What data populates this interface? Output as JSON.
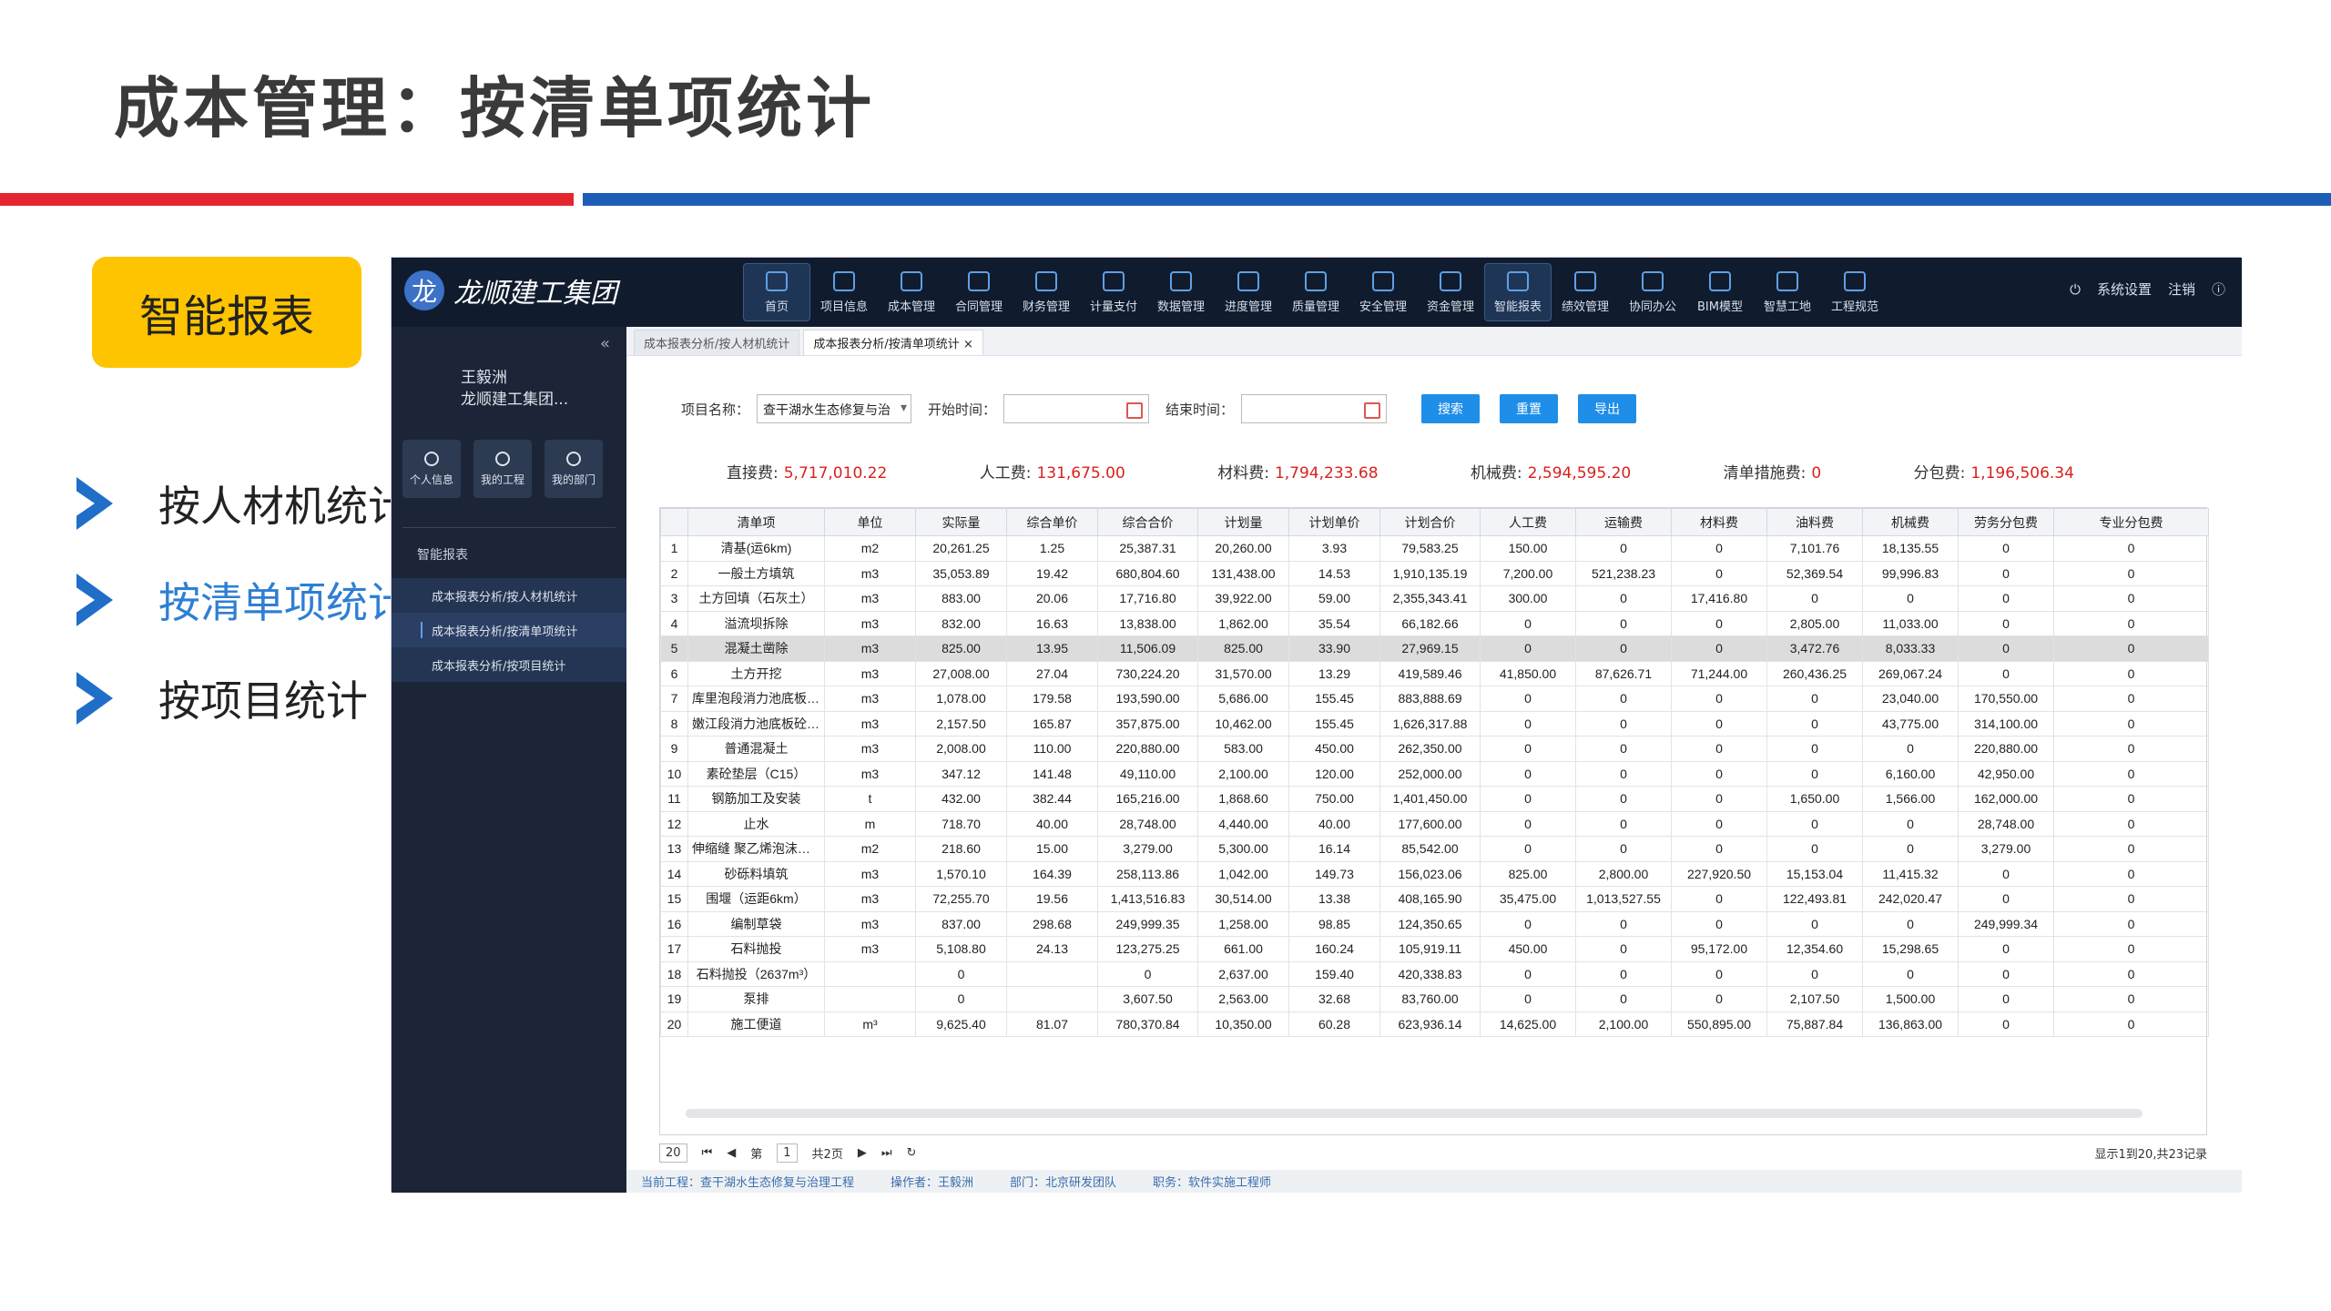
{
  "slide": {
    "title": "成本管理：按清单项统计",
    "badge": "智能报表",
    "nav": [
      "按人材机统计",
      "按清单项统计",
      "按项目统计"
    ]
  },
  "app": {
    "logo_mark": "龙",
    "logo_text": "龙顺建工集团",
    "menu": [
      "首页",
      "项目信息",
      "成本管理",
      "合同管理",
      "财务管理",
      "计量支付",
      "数据管理",
      "进度管理",
      "质量管理",
      "安全管理",
      "资金管理",
      "智能报表",
      "绩效管理",
      "协同办公",
      "BIM模型",
      "智慧工地",
      "工程规范"
    ],
    "top_right": {
      "settings": "系统设置",
      "logout": "注销",
      "help_icon": "ⓘ",
      "power_icon": "⏻"
    },
    "sidebar": {
      "collapse": "«",
      "user_name": "王毅洲",
      "user_org": "龙顺建工集团...",
      "quick": [
        "个人信息",
        "我的工程",
        "我的部门"
      ],
      "section": "智能报表",
      "subitems": [
        "成本报表分析/按人材机统计",
        "成本报表分析/按清单项统计",
        "成本报表分析/按项目统计"
      ]
    },
    "tabs": [
      "成本报表分析/按人材机统计",
      "成本报表分析/按清单项统计 ×"
    ],
    "filters": {
      "project_label": "项目名称：",
      "project_value": "查干湖水生态修复与治",
      "start_label": "开始时间：",
      "end_label": "结束时间：",
      "search": "搜索",
      "reset": "重置",
      "export": "导出"
    },
    "sums": [
      {
        "label": "直接费:",
        "value": "5,717,010.22"
      },
      {
        "label": "人工费:",
        "value": "131,675.00"
      },
      {
        "label": "材料费:",
        "value": "1,794,233.68"
      },
      {
        "label": "机械费:",
        "value": "2,594,595.20"
      },
      {
        "label": "清单措施费:",
        "value": "0"
      },
      {
        "label": "分包费:",
        "value": "1,196,506.34"
      }
    ],
    "columns": [
      "",
      "清单项",
      "单位",
      "实际量",
      "综合单价",
      "综合合价",
      "计划量",
      "计划单价",
      "计划合价",
      "人工费",
      "运输费",
      "材料费",
      "油料费",
      "机械费",
      "劳务分包费",
      "专业分包费"
    ],
    "rows": [
      [
        "1",
        "清基(运6km)",
        "m2",
        "20,261.25",
        "1.25",
        "25,387.31",
        "20,260.00",
        "3.93",
        "79,583.25",
        "150.00",
        "0",
        "0",
        "7,101.76",
        "18,135.55",
        "0",
        "0"
      ],
      [
        "2",
        "一般土方填筑",
        "m3",
        "35,053.89",
        "19.42",
        "680,804.60",
        "131,438.00",
        "14.53",
        "1,910,135.19",
        "7,200.00",
        "521,238.23",
        "0",
        "52,369.54",
        "99,996.83",
        "0",
        "0"
      ],
      [
        "3",
        "土方回填（石灰土）",
        "m3",
        "883.00",
        "20.06",
        "17,716.80",
        "39,922.00",
        "59.00",
        "2,355,343.41",
        "300.00",
        "0",
        "17,416.80",
        "0",
        "0",
        "0",
        "0"
      ],
      [
        "4",
        "溢流坝拆除",
        "m3",
        "832.00",
        "16.63",
        "13,838.00",
        "1,862.00",
        "35.54",
        "66,182.66",
        "0",
        "0",
        "0",
        "2,805.00",
        "11,033.00",
        "0",
        "0"
      ],
      [
        "5",
        "混凝土凿除",
        "m3",
        "825.00",
        "13.95",
        "11,506.09",
        "825.00",
        "33.90",
        "27,969.15",
        "0",
        "0",
        "0",
        "3,472.76",
        "8,033.33",
        "0",
        "0"
      ],
      [
        "6",
        "土方开挖",
        "m3",
        "27,008.00",
        "27.04",
        "730,224.20",
        "31,570.00",
        "13.29",
        "419,589.46",
        "41,850.00",
        "87,626.71",
        "71,244.00",
        "260,436.25",
        "269,067.24",
        "0",
        "0"
      ],
      [
        "7",
        "库里泡段消力池底板砼...",
        "m3",
        "1,078.00",
        "179.58",
        "193,590.00",
        "5,686.00",
        "155.45",
        "883,888.69",
        "0",
        "0",
        "0",
        "0",
        "23,040.00",
        "170,550.00",
        "0"
      ],
      [
        "8",
        "嫩江段消力池底板砼C...",
        "m3",
        "2,157.50",
        "165.87",
        "357,875.00",
        "10,462.00",
        "155.45",
        "1,626,317.88",
        "0",
        "0",
        "0",
        "0",
        "43,775.00",
        "314,100.00",
        "0"
      ],
      [
        "9",
        "普通混凝土",
        "m3",
        "2,008.00",
        "110.00",
        "220,880.00",
        "583.00",
        "450.00",
        "262,350.00",
        "0",
        "0",
        "0",
        "0",
        "0",
        "220,880.00",
        "0"
      ],
      [
        "10",
        "素砼垫层（C15）",
        "m3",
        "347.12",
        "141.48",
        "49,110.00",
        "2,100.00",
        "120.00",
        "252,000.00",
        "0",
        "0",
        "0",
        "0",
        "6,160.00",
        "42,950.00",
        "0"
      ],
      [
        "11",
        "钢筋加工及安装",
        "t",
        "432.00",
        "382.44",
        "165,216.00",
        "1,868.60",
        "750.00",
        "1,401,450.00",
        "0",
        "0",
        "0",
        "1,650.00",
        "1,566.00",
        "162,000.00",
        "0"
      ],
      [
        "12",
        "止水",
        "m",
        "718.70",
        "40.00",
        "28,748.00",
        "4,440.00",
        "40.00",
        "177,600.00",
        "0",
        "0",
        "0",
        "0",
        "0",
        "28,748.00",
        "0"
      ],
      [
        "13",
        "伸缩缝 聚乙烯泡沫填...",
        "m2",
        "218.60",
        "15.00",
        "3,279.00",
        "5,300.00",
        "16.14",
        "85,542.00",
        "0",
        "0",
        "0",
        "0",
        "0",
        "3,279.00",
        "0"
      ],
      [
        "14",
        "砂砾料填筑",
        "m3",
        "1,570.10",
        "164.39",
        "258,113.86",
        "1,042.00",
        "149.73",
        "156,023.06",
        "825.00",
        "2,800.00",
        "227,920.50",
        "15,153.04",
        "11,415.32",
        "0",
        "0"
      ],
      [
        "15",
        "围堰（运距6km）",
        "m3",
        "72,255.70",
        "19.56",
        "1,413,516.83",
        "30,514.00",
        "13.38",
        "408,165.90",
        "35,475.00",
        "1,013,527.55",
        "0",
        "122,493.81",
        "242,020.47",
        "0",
        "0"
      ],
      [
        "16",
        "编制草袋",
        "m3",
        "837.00",
        "298.68",
        "249,999.35",
        "1,258.00",
        "98.85",
        "124,350.65",
        "0",
        "0",
        "0",
        "0",
        "0",
        "249,999.34",
        "0"
      ],
      [
        "17",
        "石料抛投",
        "m3",
        "5,108.80",
        "24.13",
        "123,275.25",
        "661.00",
        "160.24",
        "105,919.11",
        "450.00",
        "0",
        "95,172.00",
        "12,354.60",
        "15,298.65",
        "0",
        "0"
      ],
      [
        "18",
        "石料抛投（2637m³）",
        "",
        "0",
        "",
        "0",
        "2,637.00",
        "159.40",
        "420,338.83",
        "0",
        "0",
        "0",
        "0",
        "0",
        "0",
        "0"
      ],
      [
        "19",
        "泵排",
        "",
        "0",
        "",
        "3,607.50",
        "2,563.00",
        "32.68",
        "83,760.00",
        "0",
        "0",
        "0",
        "2,107.50",
        "1,500.00",
        "0",
        "0"
      ],
      [
        "20",
        "施工便道",
        "m³",
        "9,625.40",
        "81.07",
        "780,370.84",
        "10,350.00",
        "60.28",
        "623,936.14",
        "14,625.00",
        "2,100.00",
        "550,895.00",
        "75,887.84",
        "136,863.00",
        "0",
        "0"
      ]
    ],
    "pager": {
      "size": "20",
      "page_label": "第",
      "page": "1",
      "total": "共2页",
      "summary": "显示1到20,共23记录"
    },
    "status": [
      "当前工程：查干湖水生态修复与治理工程",
      "操作者：王毅洲",
      "部门：北京研发团队",
      "职务：软件实施工程师"
    ]
  }
}
